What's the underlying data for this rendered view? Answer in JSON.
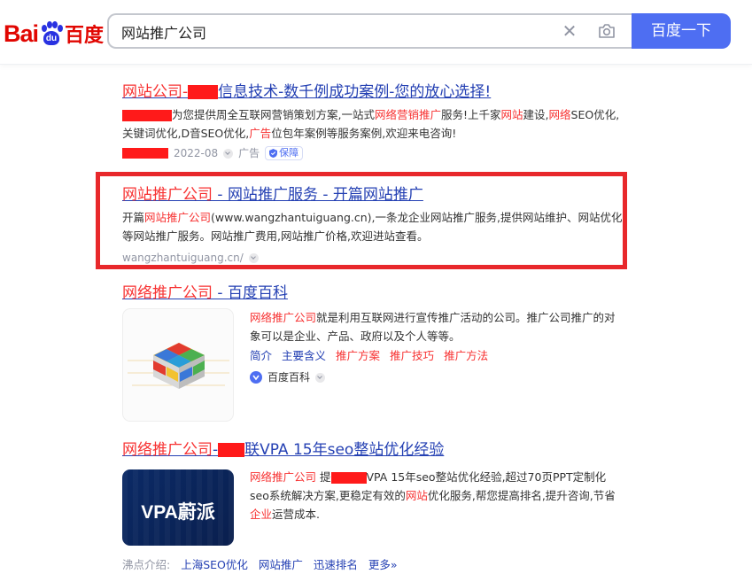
{
  "logo": {
    "text_latin": "Bai",
    "text_paw": "du",
    "text_cn": "百度"
  },
  "search": {
    "query": "网站推广公司",
    "button_label": "百度一下"
  },
  "results": [
    {
      "title_pre": "网站公司-",
      "title_post": "信息技术-数千例成功案例-您的放心选择!",
      "desc_a": "为您提供周全互联网营销策划方案,一站式",
      "desc_em1": "网络营销推广",
      "desc_b": "服务!上千家",
      "desc_em2": "网站",
      "desc_c": "建设,",
      "desc_em3": "网络",
      "desc_d": "SEO优化,关键词优化,D音SEO优化,",
      "desc_em4": "广告",
      "desc_e": "位包年案例等服务案例,欢迎来电咨询!",
      "date": "2022-08",
      "ad_label": "广告",
      "badge": "保障"
    },
    {
      "title_em": "网站推广公司",
      "title_rest": " - 网站推广服务 - 开篇网站推广",
      "desc_a": "开篇",
      "desc_em": "网站推广公司",
      "desc_b": "(www.wangzhantuiguang.cn),一条龙企业网站推广服务,提供网站维护、网站优化等网站推广服务。网站推广费用,网站推广价格,欢迎进站查看。",
      "url": "wangzhantuiguang.cn/"
    },
    {
      "title_em": "网络推广公司",
      "title_rest": " - 百度百科",
      "desc_em": "网络推广公司",
      "desc_rest": "就是利用互联网进行宣传推广活动的公司。推广公司推广的对象可以是企业、产品、政府以及个人等等。",
      "links": [
        {
          "label": "简介",
          "red": false
        },
        {
          "label": "主要含义",
          "red": false
        },
        {
          "label": "推广方案",
          "red": true
        },
        {
          "label": "推广技巧",
          "red": true
        },
        {
          "label": "推广方法",
          "red": true
        }
      ],
      "source": "百度百科"
    },
    {
      "title_em": "网络推广公司",
      "title_mid": "-",
      "title_rest": "联VPA 15年seo整站优化经验",
      "desc_em1": "网络推广公司",
      "desc_a": " 提",
      "desc_b": "VPA 15年seo整站优化经验,超过70页PPT定制化seo系统解决方案,更稳定有效的",
      "desc_em2": "网站",
      "desc_c": "优化服务,帮您提高排名,提升咨询,节省",
      "desc_em3": "企业",
      "desc_d": "运营成本.",
      "thumb_brand": "VPA蔚派",
      "bottom_label": "沸点介绍:",
      "bottom_links": [
        "上海SEO优化",
        "网站推广",
        "迅速排名",
        "更多»"
      ]
    }
  ]
}
